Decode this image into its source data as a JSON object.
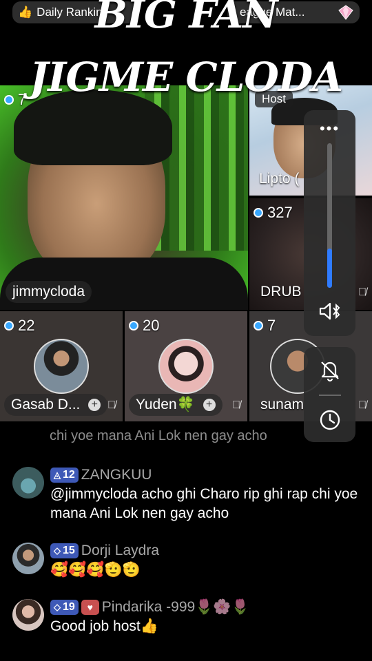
{
  "top": {
    "ranking_label": "Daily Rankin",
    "ranking_icon": "thumbs-up-emoji",
    "league_label": "eague Mat...",
    "league_icon": "diamond-icon",
    "title_line1": "BIG FAN",
    "title_line2": "JIGME CLODA"
  },
  "grid": {
    "main": {
      "viewers": "7",
      "name": "jimmycloda"
    },
    "host": {
      "badge": "Host",
      "name": "Lipto ("
    },
    "drub": {
      "viewers": "327",
      "name": "DRUB"
    },
    "small": [
      {
        "viewers": "22",
        "name": "Gasab D..."
      },
      {
        "viewers": "20",
        "name": "Yuden🍀"
      },
      {
        "viewers": "7",
        "name": "sunam"
      }
    ]
  },
  "controls": {
    "menu_label": "•••",
    "volume_level": 0.27,
    "accent": "#2f7bff"
  },
  "chat": {
    "faded_line": "chi yoe mana Ani Lok nen gay acho",
    "messages": [
      {
        "level": "12",
        "user": "ZANGKUU",
        "text": "@jimmycloda acho ghi Charo rip ghi rap chi yoe mana Ani Lok nen gay acho"
      },
      {
        "level": "15",
        "user": "Dorji Laydra",
        "text": "🥰🥰🥰🫡🫡"
      },
      {
        "level": "19",
        "user": "Pindarika -999🌷🌸🌷",
        "text": "Good job host👍"
      }
    ]
  }
}
